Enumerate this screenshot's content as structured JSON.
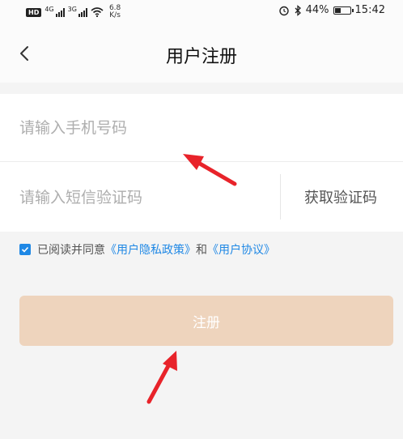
{
  "status_bar": {
    "hd_label": "HD",
    "network_1": "4G",
    "network_2": "3G",
    "speed_value": "6.8",
    "speed_unit": "K/s",
    "battery_percent": "44%",
    "battery_level": 0.44,
    "time": "15:42",
    "icons": [
      "alarm-icon",
      "bluetooth-icon",
      "wifi-icon",
      "signal-icon",
      "battery-icon"
    ]
  },
  "nav": {
    "title": "用户注册",
    "back_icon": "chevron-left-icon"
  },
  "form": {
    "phone_placeholder": "请输入手机号码",
    "phone_value": "",
    "sms_placeholder": "请输入短信验证码",
    "sms_value": "",
    "get_code_label": "获取验证码"
  },
  "agreement": {
    "checked": true,
    "text_prefix": "已阅读并同意",
    "privacy_link": "《用户隐私政策》",
    "and_text": "和",
    "terms_link": "《用户协议》"
  },
  "register_button": {
    "label": "注册"
  },
  "colors": {
    "accent": "#1f88e5",
    "button_bg": "#eed4bd",
    "arrow": "#e8232a",
    "background": "#f4f4f4"
  }
}
